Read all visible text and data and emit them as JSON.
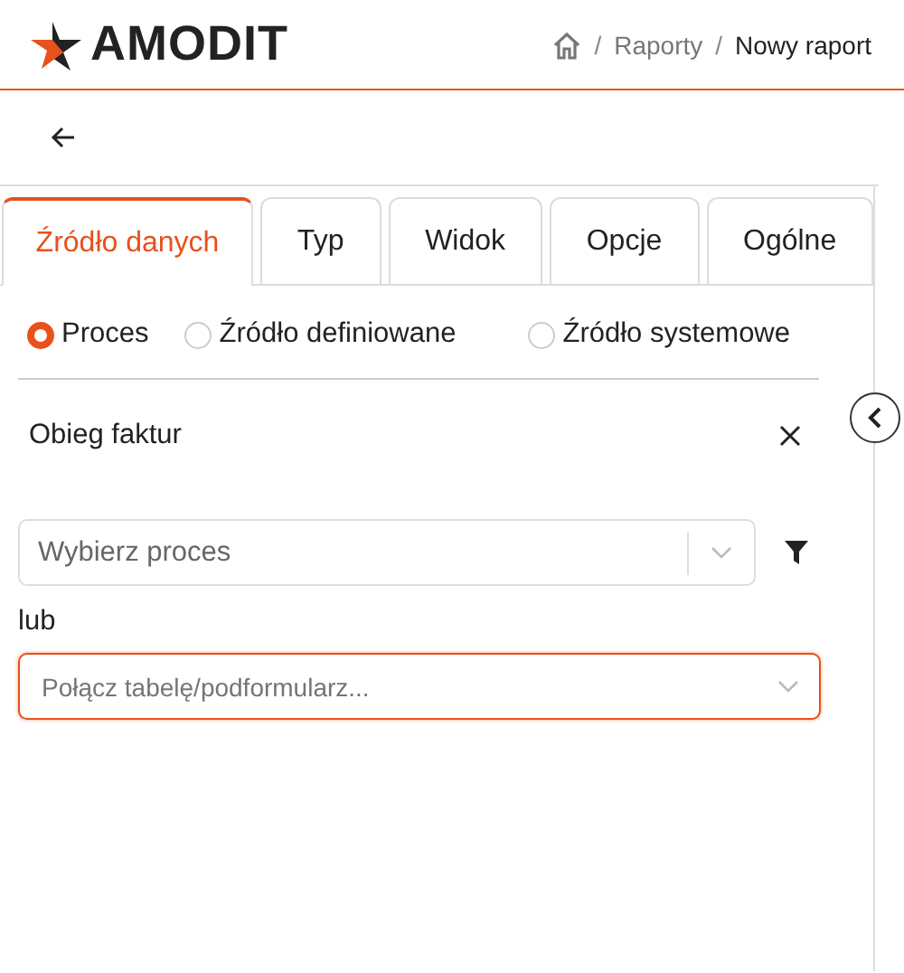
{
  "header": {
    "logo_text": "AMODIT",
    "breadcrumb": [
      {
        "separator": "/",
        "label": "Raporty"
      },
      {
        "separator": "/",
        "label": "Nowy raport"
      }
    ]
  },
  "tabs": [
    {
      "label": "Źródło danych",
      "selected": true
    },
    {
      "label": "Typ",
      "selected": false
    },
    {
      "label": "Widok",
      "selected": false
    },
    {
      "label": "Opcje",
      "selected": false
    },
    {
      "label": "Ogólne",
      "selected": false
    }
  ],
  "source_options": [
    {
      "label": "Proces",
      "selected": true
    },
    {
      "label": "Źródło definiowane",
      "selected": false
    },
    {
      "label": "Źródło systemowe",
      "selected": false
    }
  ],
  "selected_process": {
    "label": "Obieg faktur"
  },
  "process_select": {
    "placeholder": "Wybierz proces"
  },
  "or_label": "lub",
  "join_field": {
    "placeholder": "Połącz tabelę/podformularz...",
    "focused": true
  }
}
